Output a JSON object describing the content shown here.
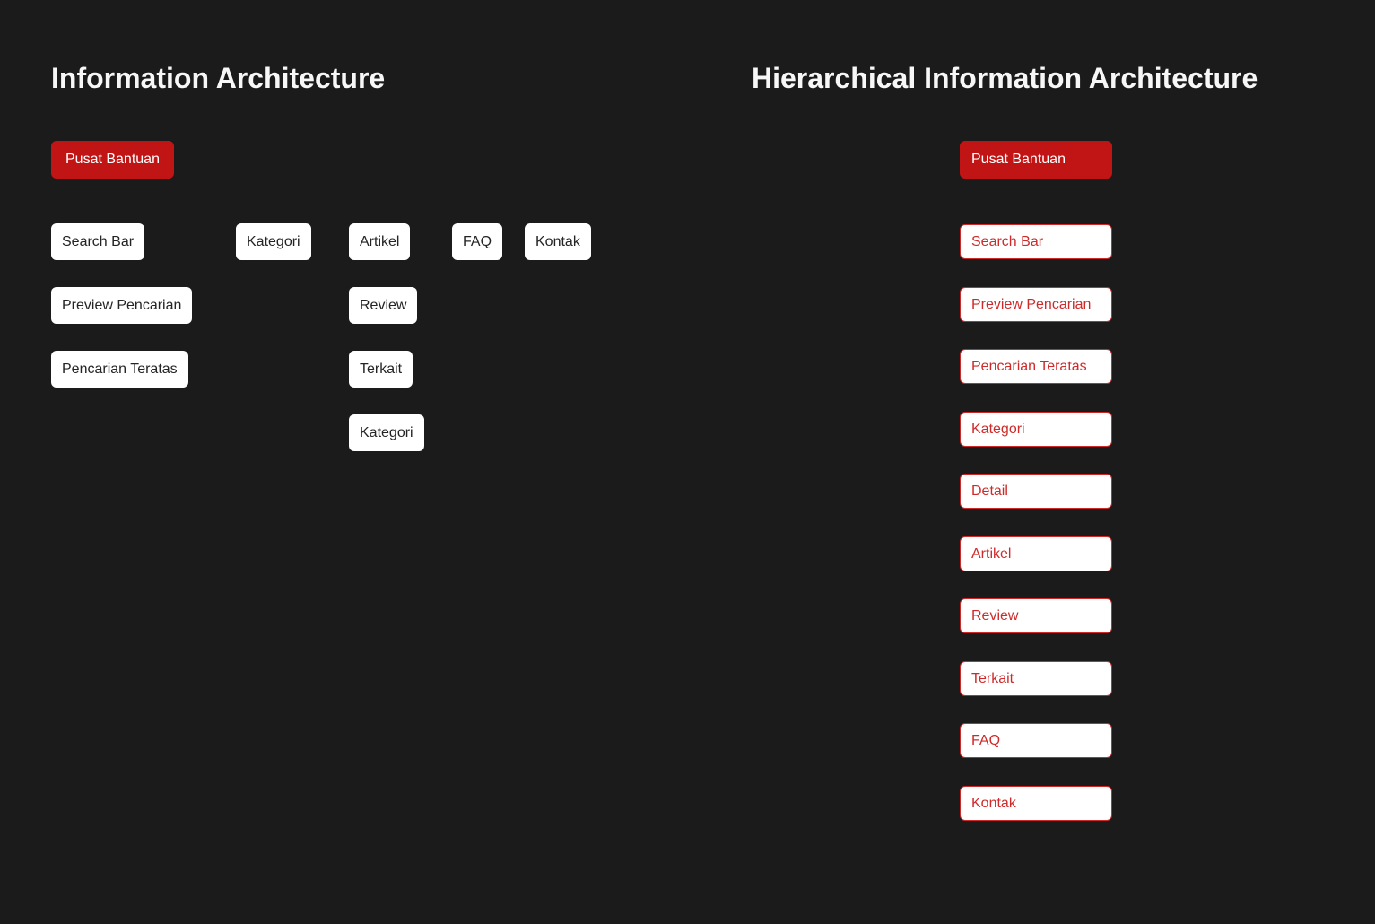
{
  "colors": {
    "canvas_background": "#1b1b1b",
    "root_button_red": "#c11414",
    "hier_node_red": "#cf2a2a",
    "node_background": "#ffffff",
    "node_text_dark": "#242424",
    "title_text": "#f7f7f7"
  },
  "left": {
    "title": "Information Architecture",
    "root_label": "Pusat Bantuan",
    "columns": [
      {
        "items": [
          "Search Bar",
          "Preview Pencarian",
          "Pencarian Teratas"
        ]
      },
      {
        "items": [
          "Kategori"
        ]
      },
      {
        "items": [
          "Artikel",
          "Review",
          "Terkait",
          "Kategori"
        ]
      },
      {
        "items": [
          "FAQ"
        ]
      },
      {
        "items": [
          "Kontak"
        ]
      }
    ]
  },
  "right": {
    "title": "Hierarchical Information Architecture",
    "root_label": "Pusat Bantuan",
    "items": [
      "Search Bar",
      "Preview Pencarian",
      "Pencarian Teratas",
      "Kategori",
      "Detail",
      "Artikel",
      "Review",
      "Terkait",
      "FAQ",
      "Kontak"
    ]
  }
}
